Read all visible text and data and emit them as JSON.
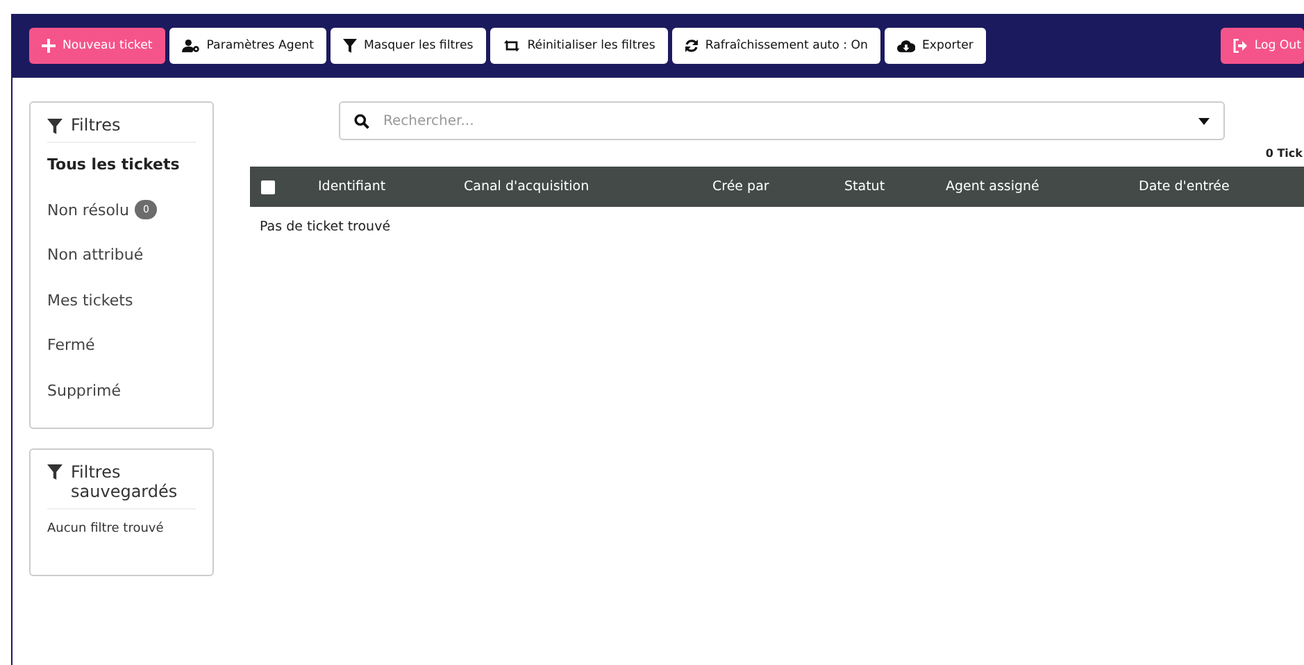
{
  "toolbar": {
    "buttons": [
      {
        "label": "Nouveau ticket",
        "kind": "primary"
      },
      {
        "label": "Paramètres Agent",
        "kind": "default"
      },
      {
        "label": "Masquer les filtres",
        "kind": "default"
      },
      {
        "label": "Réinitialiser les filtres",
        "kind": "default"
      },
      {
        "label": "Rafraîchissement auto : On",
        "kind": "default"
      },
      {
        "label": "Exporter",
        "kind": "default"
      }
    ],
    "logout": {
      "label": "Log Out"
    }
  },
  "filters": {
    "title": "Filtres",
    "items": [
      {
        "label": "Tous les tickets",
        "selected": true
      },
      {
        "label": "Non résolu",
        "selected": false,
        "badge": "0"
      },
      {
        "label": "Non attribué",
        "selected": false
      },
      {
        "label": "Mes tickets",
        "selected": false
      },
      {
        "label": "Fermé",
        "selected": false
      },
      {
        "label": "Supprimé",
        "selected": false
      }
    ]
  },
  "saved_filters": {
    "title": "Filtres sauvegardés",
    "empty": "Aucun filtre trouvé"
  },
  "search": {
    "placeholder": "Rechercher..."
  },
  "ticket_count": "0 Tick",
  "table": {
    "select_all_checked": false,
    "columns": [
      "Identifiant",
      "Canal d'acquisition",
      "Crée par",
      "Statut",
      "Agent assigné",
      "Date d'entrée"
    ],
    "empty": "Pas de ticket trouvé"
  }
}
